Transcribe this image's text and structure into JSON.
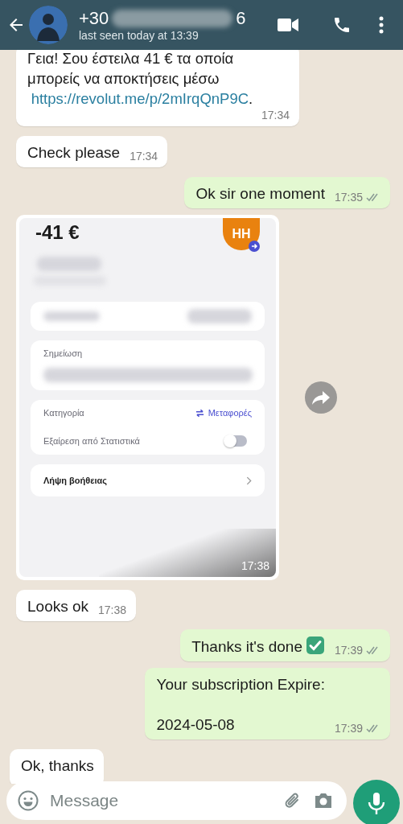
{
  "header": {
    "title_start": "+30",
    "title_end": "6",
    "status": "last seen today at 13:39"
  },
  "messages": [
    {
      "kind": "text",
      "outgoing": false,
      "text": "Γεια! Σου έστειλα 41 € τα οποία μπορείς να αποκτήσεις μέσω",
      "link": "https://revolut.me/p/2mIrqQnP9C",
      "suffix": ".",
      "time": "17:34"
    },
    {
      "kind": "text",
      "outgoing": false,
      "text": "Check please",
      "time": "17:34"
    },
    {
      "kind": "text",
      "outgoing": true,
      "text": "Ok sir one moment",
      "time": "17:35",
      "read": false
    },
    {
      "kind": "image",
      "outgoing": false,
      "time": "17:38",
      "screenshot": {
        "amount": "-41 €",
        "initials": "HH",
        "note_label": "Σημείωση",
        "category_label": "Κατηγορία",
        "category_value": "Μεταφορές",
        "exclude_label": "Εξαίρεση από Στατιστικά",
        "exclude_on": false,
        "help_label": "Λήψη βοήθειας"
      }
    },
    {
      "kind": "text",
      "outgoing": false,
      "text": "Looks ok",
      "time": "17:38"
    },
    {
      "kind": "text",
      "outgoing": true,
      "text": "Thanks it's done",
      "check_emoji": true,
      "time": "17:39",
      "read": false
    },
    {
      "kind": "text",
      "outgoing": true,
      "text": "Your subscription Expire:\n\n2024-05-08",
      "time": "17:39",
      "read": false
    },
    {
      "kind": "text",
      "outgoing": false,
      "text": "Ok, thanks"
    }
  ],
  "composer": {
    "placeholder": "Message"
  }
}
